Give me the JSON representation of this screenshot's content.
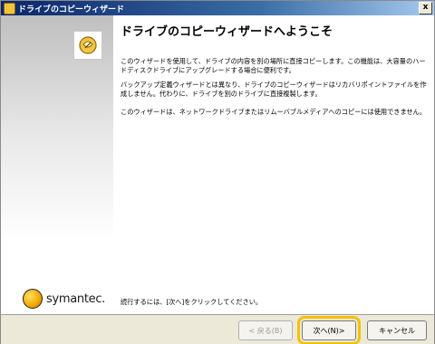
{
  "window": {
    "title": "ドライブのコピーウィザード",
    "close_label": "x"
  },
  "sidebar": {
    "brand_name": "symantec."
  },
  "content": {
    "heading": "ドライブのコピーウィザードへようこそ",
    "paragraphs": [
      "このウィザードを使用して、ドライブの内容を別の場所に直接コピーします。この機能は、大容量のハードディスクドライブにアップグレードする場合に便利です。",
      "バックアップ定義ウィザードとは異なり、ドライブのコピーウィザードはリカバリポイントファイルを作成しません。代わりに、ドライブを別のドライブに直接複製します。",
      "このウィザードは、ネットワークドライブまたはリムーバブルメディアへのコピーには使用できません。"
    ],
    "footer_note": "続行するには、[次へ]をクリックしてください。"
  },
  "buttons": {
    "back": "< 戻る(B)",
    "next": "次へ(N)>",
    "cancel": "キャンセル"
  }
}
